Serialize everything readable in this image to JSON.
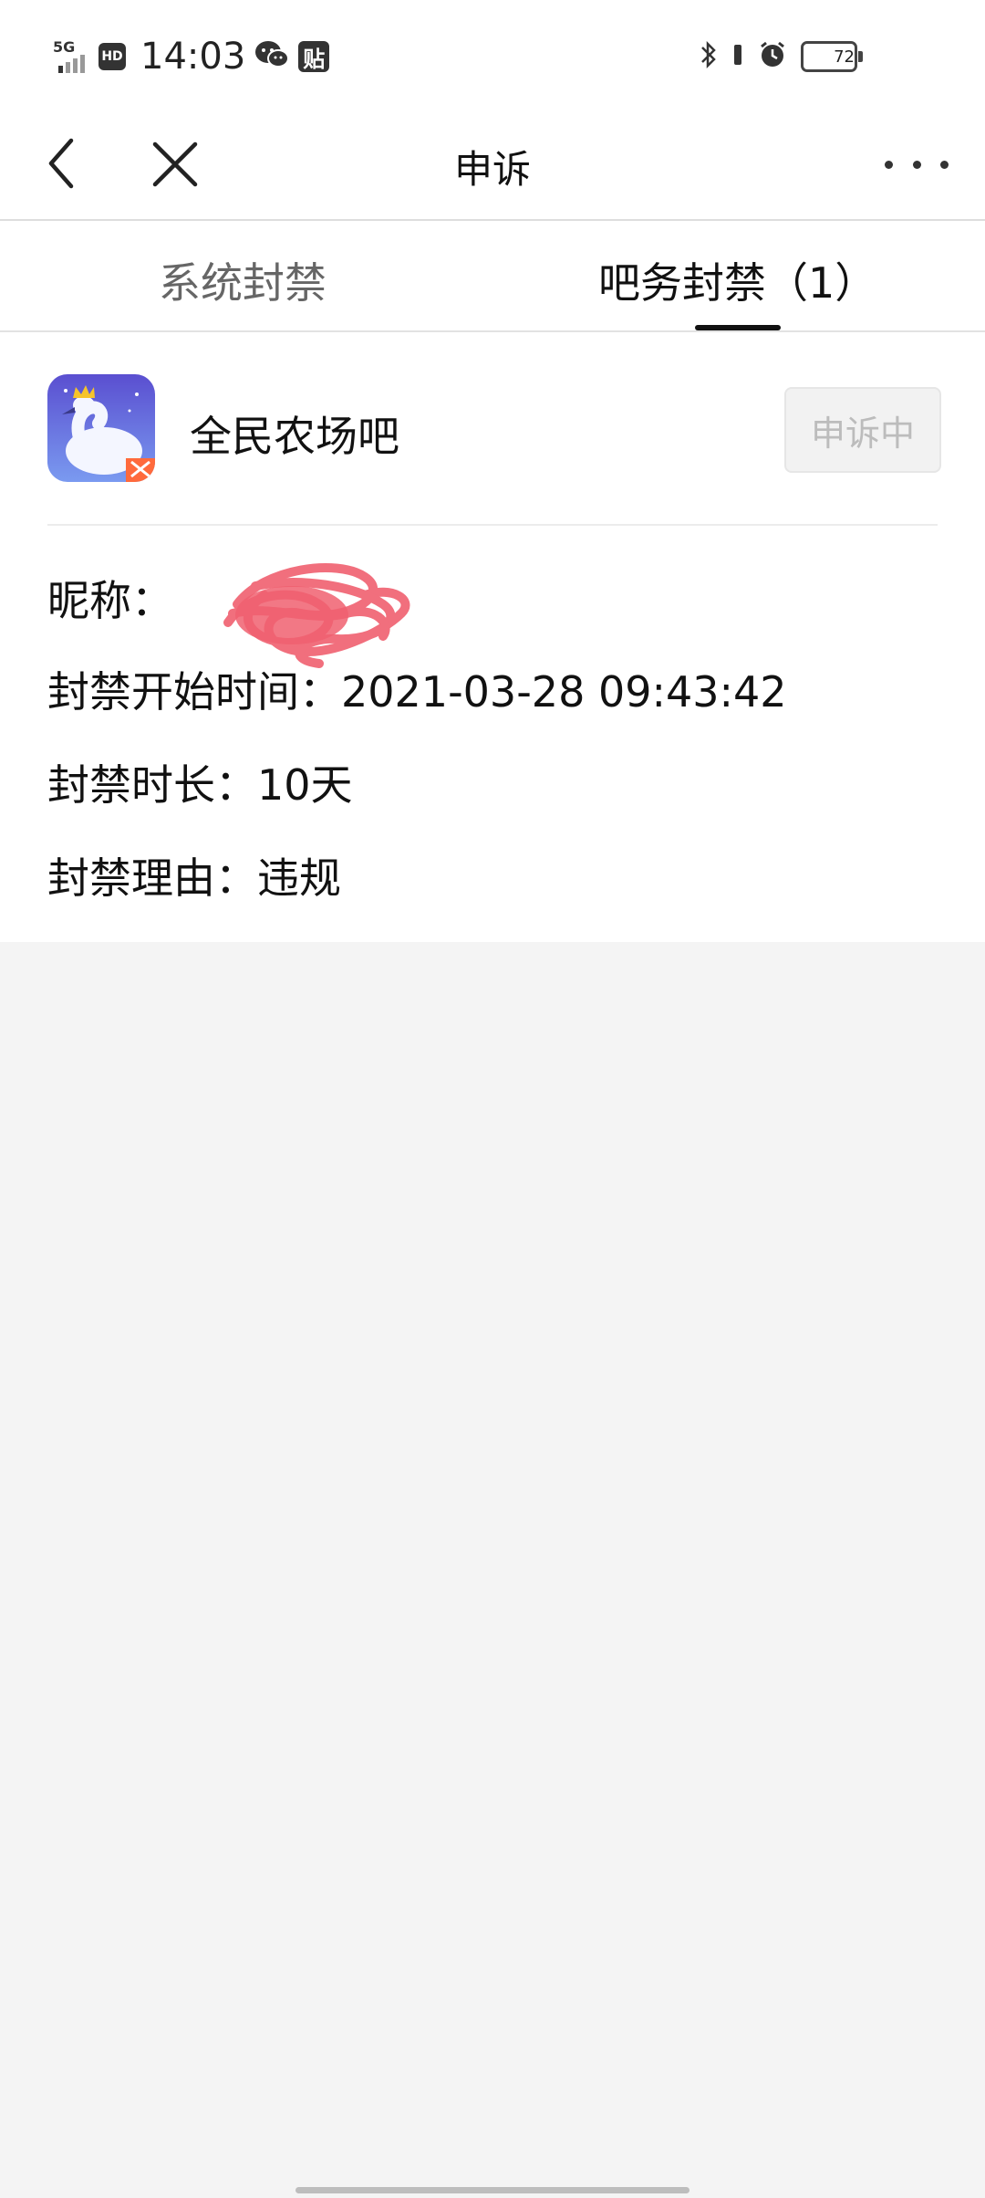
{
  "status_bar": {
    "network": "5G",
    "hd_badge": "HD",
    "time": "14:03",
    "tieba_badge": "贴",
    "battery_level": "72"
  },
  "nav": {
    "title": "申诉"
  },
  "tabs": [
    {
      "label": "系统封禁",
      "active": false
    },
    {
      "label": "吧务封禁（1）",
      "active": true
    }
  ],
  "ban": {
    "forum_name": "全民农场吧",
    "appeal_status": "申诉中",
    "nickname_label": "昵称：",
    "start_label": "封禁开始时间：",
    "start_value": "2021-03-28 09:43:42",
    "duration_label": "封禁时长：",
    "duration_value": "10天",
    "reason_label": "封禁理由：",
    "reason_value": "违规"
  },
  "colors": {
    "accent_underline": "#111111",
    "redaction": "#f06070",
    "page_bg": "#f4f4f4"
  }
}
